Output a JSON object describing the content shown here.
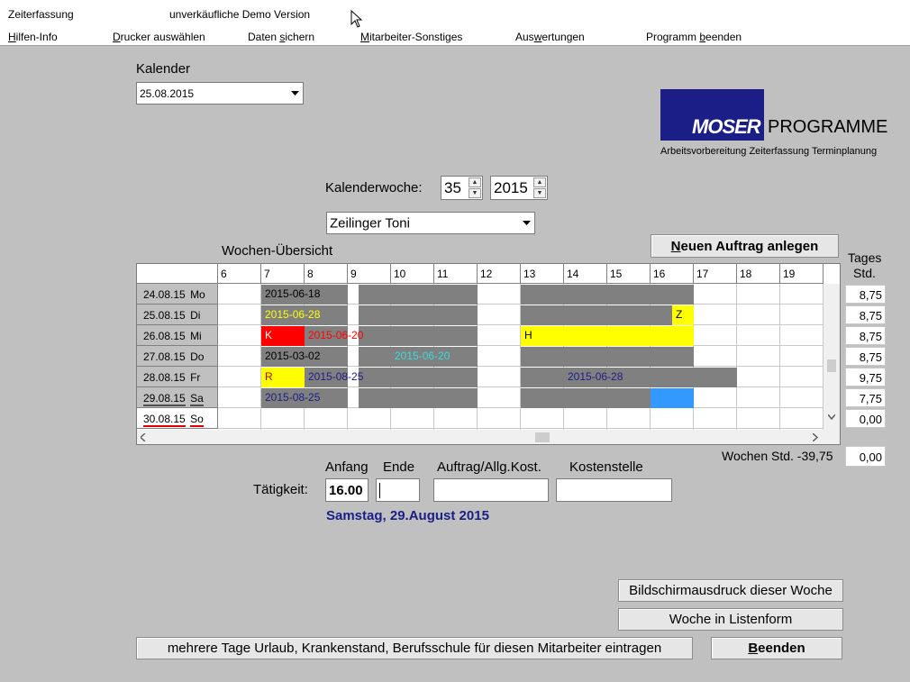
{
  "app": {
    "title": "Zeiterfassung",
    "demo_notice": "unverkäufliche Demo Version"
  },
  "menu": [
    {
      "pre": "",
      "ul": "H",
      "post": "ilfen-Info"
    },
    {
      "pre": "",
      "ul": "D",
      "post": "rucker auswählen"
    },
    {
      "pre": "Daten ",
      "ul": "s",
      "post": "ichern"
    },
    {
      "pre": "",
      "ul": "M",
      "post": "itarbeiter-Sonstiges"
    },
    {
      "pre": "Aus",
      "ul": "w",
      "post": "ertungen"
    },
    {
      "pre": "Programm ",
      "ul": "b",
      "post": "eenden"
    }
  ],
  "calendar": {
    "label": "Kalender",
    "date": "25.08.2015"
  },
  "logo": {
    "brand": "MOSER",
    "programme": "PROGRAMME",
    "tagline": "Arbeitsvorbereitung Zeiterfassung Terminplanung"
  },
  "week": {
    "label": "Kalenderwoche:",
    "number": "35",
    "year": "2015"
  },
  "employee": "Zeilinger Toni",
  "buttons": {
    "new_order_ul": "N",
    "new_order_rest": "euen Auftrag anlegen",
    "print_week": "Bildschirmausdruck dieser Woche",
    "week_list": "Woche in Listenform",
    "multi_days": "mehrere Tage Urlaub, Krankenstand, Berufsschule für diesen Mitarbeiter eintragen",
    "quit_ul": "B",
    "quit_rest": "eenden"
  },
  "overview": {
    "title": "Wochen-Übersicht",
    "hours": [
      "6",
      "7",
      "8",
      "9",
      "10",
      "11",
      "12",
      "13",
      "14",
      "15",
      "16",
      "17",
      "18",
      "19"
    ],
    "days": [
      {
        "date": "24.08.15",
        "day": "Mo"
      },
      {
        "date": "25.08.15",
        "day": "Di"
      },
      {
        "date": "26.08.15",
        "day": "Mi"
      },
      {
        "date": "27.08.15",
        "day": "Do"
      },
      {
        "date": "28.08.15",
        "day": "Fr"
      },
      {
        "date": "29.08.15",
        "day": "Sa"
      },
      {
        "date": "30.08.15",
        "day": "So"
      }
    ],
    "tags_label_1": "Tages",
    "tags_label_2": "Std.",
    "day_hours": [
      "8,75",
      "8,75",
      "8,75",
      "8,75",
      "9,75",
      "7,75",
      "0,00"
    ],
    "week_hours_label": "Wochen Std. -39,75",
    "week_hours_value": "0,00",
    "entries": [
      "2015-06-18",
      "2015-06-28",
      "Z",
      "K",
      "2015-06-20",
      "H",
      "2015-03-02",
      "2015-06-20",
      "R",
      "2015-08-25",
      "2015-06-28",
      "2015-08-25"
    ]
  },
  "activity": {
    "label": "Tätigkeit:",
    "col_start": "Anfang",
    "col_end": "Ende",
    "col_order": "Auftrag/Allg.Kost.",
    "col_cost": "Kostenstelle",
    "start_value": "16.00",
    "end_value": "",
    "order_value": "",
    "cost_value": "",
    "selected_date": "Samstag, 29.August 2015"
  },
  "colors": {
    "gray_block": "#808080",
    "yellow": "#ffff00",
    "red": "#ff0000",
    "blue": "#3399ff",
    "navy_text": "#1b1e86"
  }
}
